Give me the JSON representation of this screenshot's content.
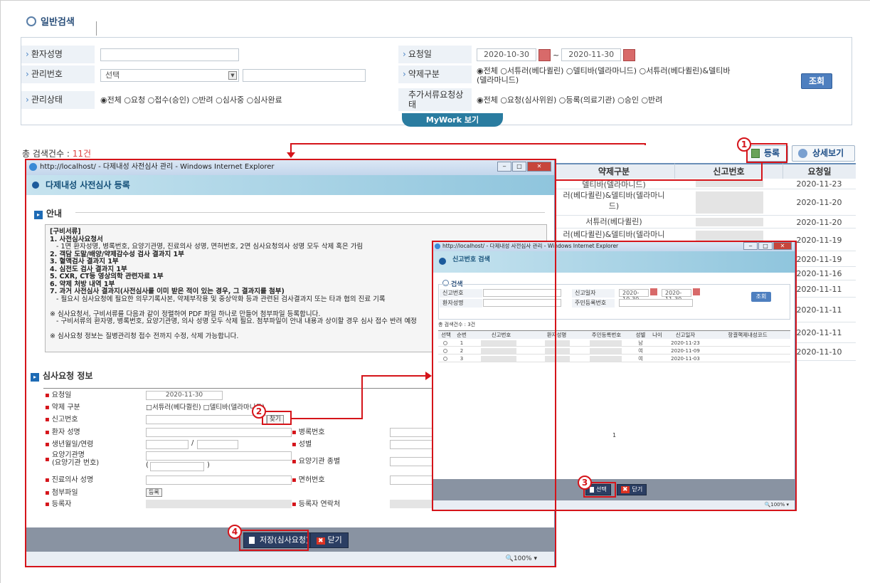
{
  "search": {
    "title": "일반검색",
    "patient_name_label": "환자성명",
    "request_date_label": "요청일",
    "date_from": "2020-10-30",
    "date_to": "2020-11-30",
    "tilde": "~",
    "mgmt_no_label": "관리번호",
    "mgmt_select": "선택",
    "drug_label": "약제구분",
    "drug_options_line1": "◉전체 ○서튜러(베다퀼린) ○델티바(델라마니드) ○서튜러(베다퀼린)&델티바",
    "drug_options_line2": "(델라마니드)",
    "status_label": "관리상태",
    "status_options": "◉전체 ○요청 ○접수(승인) ○반려 ○심사중 ○심사완료",
    "extra_label_1": "추가서류요청상",
    "extra_label_2": "태",
    "extra_options": "◉전체 ○요청(심사위원) ○등록(의료기관) ○승인 ○반려",
    "search_button": "조회",
    "mywork_tab": "MyWork 보기"
  },
  "results": {
    "total_prefix": "총 검색건수 : ",
    "total_count": "11건",
    "register_button": "등록",
    "detail_button": "상세보기",
    "headers": [
      "약제구분",
      "신고번호",
      "요청일"
    ],
    "rows": [
      {
        "drug": "델티바(델라마니드)",
        "date": "2020-11-23"
      },
      {
        "drug": "러(베다퀼린)&델티바(델라마니",
        "drug2": "드)",
        "date": "2020-11-20"
      },
      {
        "drug": "서튜러(베다퀼린)",
        "date": "2020-11-20"
      },
      {
        "drug": "러(베다퀼린)&델티바(델라마니",
        "date": "2020-11-19"
      },
      {
        "drug": "",
        "date": "2020-11-19"
      },
      {
        "drug": "",
        "date": "2020-11-16"
      },
      {
        "drug": "",
        "date": "2020-11-11"
      },
      {
        "drug": "",
        "date": "2020-11-11"
      },
      {
        "drug": "",
        "date": "2020-11-11"
      },
      {
        "drug": "",
        "date": "2020-11-10"
      }
    ]
  },
  "win1": {
    "title": "http://localhost/ - 다제내성 사전심사 관리 - Windows Internet Explorer",
    "banner": "다제내성 사전심사 등록",
    "notice_section": "안내",
    "notice_lines": [
      {
        "t": "[구비서류]",
        "b": true
      },
      {
        "t": "1. 사전심사요청서",
        "b": true
      },
      {
        "t": "   - 1면 환자성명, 병록번호, 요양기관명, 진료의사 성명, 면허번호, 2면 심사요청의사 성명 모두 삭제 혹은 가림",
        "b": false
      },
      {
        "t": "2. 객담 도말/배양/약제감수성 검사 결과지 1부",
        "b": true
      },
      {
        "t": "3. 혈액검사 결과지 1부",
        "b": true
      },
      {
        "t": "4. 심전도 검사 결과지 1부",
        "b": true
      },
      {
        "t": "5. CXR, CT등 영상의학 관련자료 1부",
        "b": true
      },
      {
        "t": "6. 약제 처방 내역 1부",
        "b": true
      },
      {
        "t": "7. 과거 사전심사 결과지(사전심사를 이미 받은 적이 있는 경우, 그 결과지를 첨부)",
        "b": true
      },
      {
        "t": "   - 필요시 심사요청에 필요한 의무기록사본, 약제부작용 및 중상악화 등과 관련된 검사결과지 또는 타과 협의 진료 기록",
        "b": false
      },
      {
        "t": "",
        "b": false
      },
      {
        "t": "※ 심사요청서, 구비서류를 다음과 같이 정렬하여 PDF 파일 하나로 만들어 첨부파일 등록합니다.",
        "b": false
      },
      {
        "t": "   - 구비서류의 환자명, 병록번호, 요양기관명, 의사 성명 모두 삭제 필요. 첨부파일이 안내 내용과 상이할 경우 심사 접수 반려 예정",
        "b": false
      },
      {
        "t": "",
        "b": false
      },
      {
        "t": "※ 심사요청 정보는 질병관리청 접수 전까지 수정, 삭제 가능합니다.",
        "b": false
      }
    ],
    "form_section": "심사요청 정보",
    "f_request_date": "요청일",
    "f_request_date_val": "2020-11-30",
    "f_drug": "약제 구분",
    "f_drug_val": "□서튜러(베다퀼린) □델티바(델라마니드)",
    "f_report_no": "신고번호",
    "find_button": "찾기",
    "f_patient": "환자 성명",
    "f_chart_no": "병록번호",
    "f_birth": "생년월일/연령",
    "f_slash": "/",
    "f_gender": "성별",
    "f_hospital_1": "요양기관명",
    "f_hospital_2": "(요양기관 번호)",
    "f_paren_open": "(",
    "f_paren_close": ")",
    "f_hospital_type": "요양기관 종별",
    "f_doctor": "진료의사 성명",
    "f_license": "면허번호",
    "f_attach": "첨부파일",
    "attach_button": "등록",
    "f_registrant": "등록자",
    "f_reg_contact": "등록자 연락처",
    "save_button": "저장(심사요청)",
    "close_button": "닫기",
    "zoom": "🔍100%  ▾"
  },
  "win2": {
    "title": "http://localhost/ - 다제내성 사전심사 관리 - Windows Internet Explorer",
    "banner": "신고번호 검색",
    "search_title": "검색",
    "l_report_no": "신고번호",
    "l_report_date": "신고일자",
    "date_from": "2020-10-30",
    "date_to": "2020-11-30",
    "l_patient": "환자성명",
    "l_resident_no": "주민등록번호",
    "search_button": "조회",
    "total": "총 검색건수 : 3건",
    "headers": [
      "선택",
      "순번",
      "신고번호",
      "환자성명",
      "주민등록번호",
      "성별",
      "나이",
      "신고일자",
      "항결핵제내성코드"
    ],
    "rows": [
      {
        "no": "1",
        "gender": "남",
        "date": "2020-11-23"
      },
      {
        "no": "2",
        "gender": "여",
        "date": "2020-11-09"
      },
      {
        "no": "3",
        "gender": "여",
        "date": "2020-11-03"
      }
    ],
    "page": "1",
    "select_button": "선택",
    "close_button": "닫기",
    "zoom": "🔍100%  ▾"
  },
  "steps": [
    "1",
    "2",
    "3",
    "4"
  ]
}
